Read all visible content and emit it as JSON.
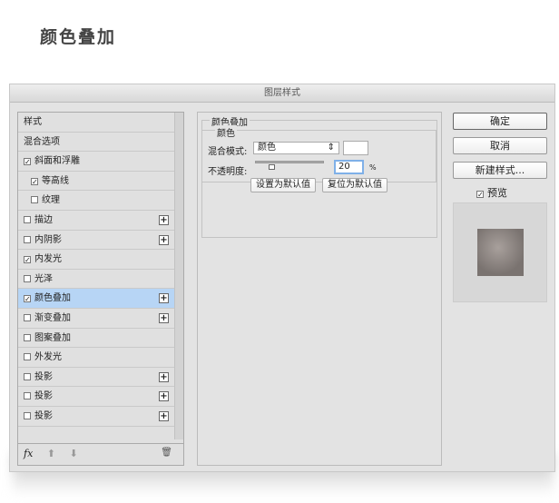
{
  "heading": "颜色叠加",
  "dialog": {
    "title": "图层样式"
  },
  "styles": [
    {
      "label": "样式",
      "checkbox": false,
      "checked": false,
      "indent": false,
      "plus": false
    },
    {
      "label": "混合选项",
      "checkbox": false,
      "checked": false,
      "indent": false,
      "plus": false
    },
    {
      "label": "斜面和浮雕",
      "checkbox": true,
      "checked": true,
      "indent": false,
      "plus": false
    },
    {
      "label": "等高线",
      "checkbox": true,
      "checked": true,
      "indent": true,
      "plus": false
    },
    {
      "label": "纹理",
      "checkbox": true,
      "checked": false,
      "indent": true,
      "plus": false
    },
    {
      "label": "描边",
      "checkbox": true,
      "checked": false,
      "indent": false,
      "plus": true
    },
    {
      "label": "内阴影",
      "checkbox": true,
      "checked": false,
      "indent": false,
      "plus": true
    },
    {
      "label": "内发光",
      "checkbox": true,
      "checked": true,
      "indent": false,
      "plus": false
    },
    {
      "label": "光泽",
      "checkbox": true,
      "checked": false,
      "indent": false,
      "plus": false
    },
    {
      "label": "颜色叠加",
      "checkbox": true,
      "checked": true,
      "indent": false,
      "plus": true,
      "selected": true
    },
    {
      "label": "渐变叠加",
      "checkbox": true,
      "checked": false,
      "indent": false,
      "plus": true
    },
    {
      "label": "图案叠加",
      "checkbox": true,
      "checked": false,
      "indent": false,
      "plus": false
    },
    {
      "label": "外发光",
      "checkbox": true,
      "checked": false,
      "indent": false,
      "plus": false
    },
    {
      "label": "投影",
      "checkbox": true,
      "checked": false,
      "indent": false,
      "plus": true
    },
    {
      "label": "投影",
      "checkbox": true,
      "checked": false,
      "indent": false,
      "plus": true
    },
    {
      "label": "投影",
      "checkbox": true,
      "checked": false,
      "indent": false,
      "plus": true
    }
  ],
  "toolbar": {
    "fx": "fx",
    "up": "⬆",
    "down": "⬇",
    "trash": "🗑"
  },
  "panel": {
    "group_title": "颜色叠加",
    "subgroup_title": "颜色",
    "blend_label": "混合模式:",
    "blend_value": "颜色",
    "swatch_color": "#ffffff",
    "opacity_label": "不透明度:",
    "opacity_value": "20",
    "opacity_unit": "%",
    "opacity_fraction": 0.2,
    "set_default": "设置为默认值",
    "reset_default": "复位为默认值"
  },
  "buttons": {
    "ok": "确定",
    "cancel": "取消",
    "new_style": "新建样式..."
  },
  "preview": {
    "label": "预览",
    "checked": true
  }
}
